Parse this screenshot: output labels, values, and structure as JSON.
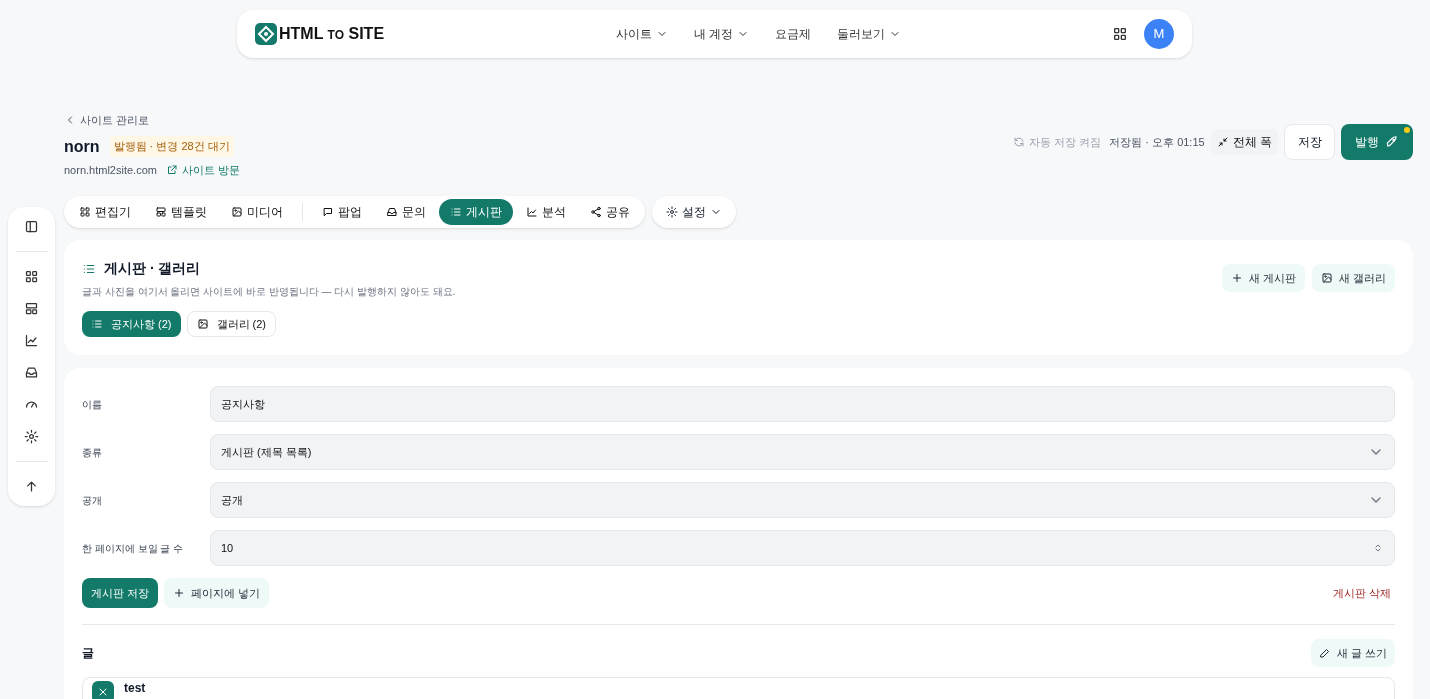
{
  "topbar": {
    "logo_text": "HTML",
    "logo_small": "TO",
    "logo_text2": "SITE",
    "nav": [
      {
        "label": "사이트",
        "dropdown": true
      },
      {
        "label": "내 계정",
        "dropdown": true
      },
      {
        "label": "요금제",
        "dropdown": false
      },
      {
        "label": "둘러보기",
        "dropdown": true
      }
    ],
    "avatar": "M"
  },
  "header": {
    "back_link": "사이트 관리로",
    "site_name": "norn",
    "status_badge": "발행됨 · 변경 28건 대기",
    "domain": "norn.html2site.com",
    "visit_link": "사이트 방문",
    "autosave": "자동 저장 켜짐",
    "saved_time": "저장됨 · 오후 01:15",
    "full_width": "전체 폭",
    "save": "저장",
    "publish": "발행",
    "publish_pending": true
  },
  "tabs": [
    {
      "label": "편집기",
      "selected": false
    },
    {
      "label": "템플릿",
      "selected": false
    },
    {
      "label": "미디어",
      "selected": false
    },
    {
      "label": "팝업",
      "selected": false
    },
    {
      "label": "문의",
      "selected": false
    },
    {
      "label": "게시판",
      "selected": true
    },
    {
      "label": "분석",
      "selected": false
    },
    {
      "label": "공유",
      "selected": false
    }
  ],
  "settings_tab": "설정",
  "board_panel": {
    "title": "게시판 · 갤러리",
    "description": "글과 사진을 여기서 올리면 사이트에 바로 반영됩니다 — 다시 발행하지 않아도 돼요.",
    "new_board": "새 게시판",
    "new_gallery": "새 갤러리",
    "boards": [
      {
        "label": "공지사항 (2)",
        "kind": "list",
        "selected": true
      },
      {
        "label": "갤러리 (2)",
        "kind": "gallery",
        "selected": false
      }
    ]
  },
  "form": {
    "fields": [
      {
        "label": "이름",
        "kind": "text",
        "value": "공지사항"
      },
      {
        "label": "종류",
        "kind": "select",
        "value": "게시판 (제목 목록)"
      },
      {
        "label": "공개",
        "kind": "select",
        "value": "공개"
      },
      {
        "label": "한 페이지에 보일 글 수",
        "kind": "number",
        "value": "10"
      }
    ],
    "save_board": "게시판 저장",
    "insert_page": "페이지에 넣기",
    "delete_board": "게시판 삭제"
  },
  "posts": {
    "heading": "글",
    "new_post": "새 글 쓰기",
    "items": [
      {
        "title": "test"
      }
    ]
  }
}
